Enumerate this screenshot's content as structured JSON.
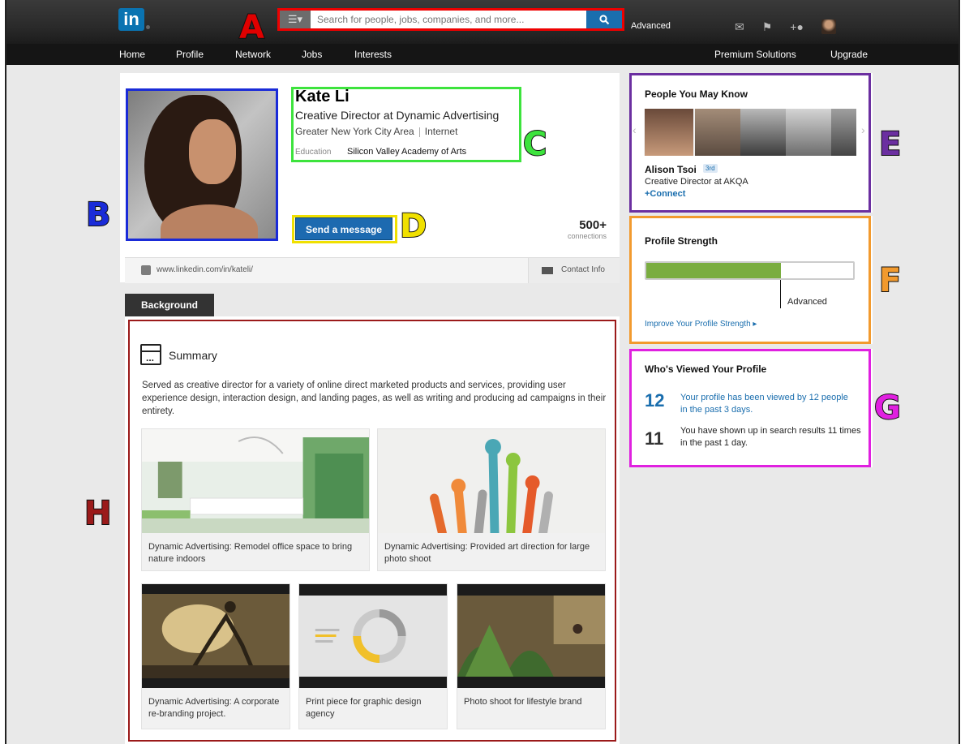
{
  "header": {
    "logo_text": "in",
    "search_placeholder": "Search for people, jobs, companies, and more...",
    "search_category_icon": "list-icon",
    "advanced_label": "Advanced",
    "icons": [
      "mail-icon",
      "flag-icon",
      "add-connection-icon",
      "user-avatar-icon"
    ]
  },
  "nav": {
    "home": "Home",
    "profile": "Profile",
    "network": "Network",
    "jobs": "Jobs",
    "interests": "Interests",
    "premium": "Premium Solutions",
    "upgrade": "Upgrade"
  },
  "annotations": {
    "a": "A",
    "b": "B",
    "c": "C",
    "d": "D",
    "e": "E",
    "f": "F",
    "g": "G",
    "h": "H"
  },
  "annotation_colors": {
    "a": "#e00000",
    "b": "#1a2bd8",
    "c": "#3de33d",
    "d": "#f0e000",
    "e": "#6b2fa0",
    "f": "#f29a2e",
    "g": "#e020e0",
    "h": "#9b1a1a"
  },
  "profile": {
    "name": "Kate Li",
    "headline": "Creative Director at Dynamic Advertising",
    "location": "Greater New York City Area",
    "industry": "Internet",
    "education_label": "Education",
    "education_value": "Silicon Valley Academy of Arts",
    "message_button": "Send a message",
    "connections_count": "500+",
    "connections_label": "connections",
    "public_url": "www.linkedin.com/in/kateli/",
    "contact_info": "Contact Info"
  },
  "background": {
    "tab_label": "Background",
    "summary_title": "Summary",
    "summary_text": "Served as creative director for a variety of online direct marketed products and services, providing user experience design, interaction design, and landing pages, as well as writing and producing ad campaigns in their entirety.",
    "media": [
      {
        "caption": "Dynamic Advertising: Remodel office space to bring nature indoors"
      },
      {
        "caption": "Dynamic Advertising: Provided art direction for large photo shoot"
      },
      {
        "caption": "Dynamic Advertising: A corporate re-branding project."
      },
      {
        "caption": "Print piece for graphic design agency"
      },
      {
        "caption": "Photo shoot for lifestyle brand"
      }
    ]
  },
  "pymk": {
    "title": "People You May Know",
    "person_name": "Alison Tsoi",
    "degree": "3rd",
    "person_title": "Creative Director at AKQA",
    "connect_label": "+Connect"
  },
  "strength": {
    "title": "Profile Strength",
    "level": "Advanced",
    "fill_percent": 65,
    "improve_link": "Improve Your Profile Strength"
  },
  "viewed": {
    "title": "Who's Viewed Your Profile",
    "views_count": "12",
    "views_text": "Your profile has been viewed by 12 people in the past 3 days.",
    "search_count": "11",
    "search_text": "You have shown up in search results 11 times in the past 1 day."
  }
}
